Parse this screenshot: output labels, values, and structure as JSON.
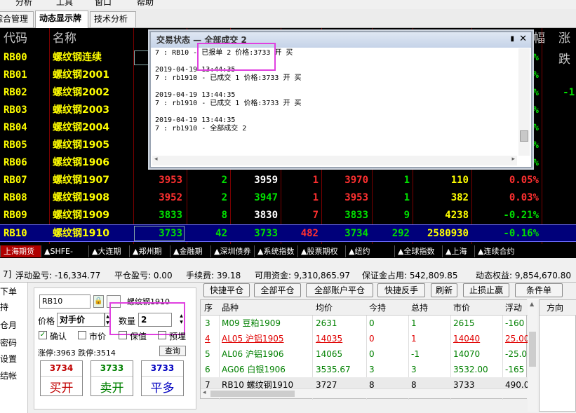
{
  "menu": {
    "items": [
      "分析",
      "工具",
      "窗口",
      "帮助"
    ]
  },
  "tabs": [
    "综合管理",
    "动态显示牌",
    "技术分析"
  ],
  "quote": {
    "headers": {
      "code": "代码",
      "name": "名称",
      "fu": "幅",
      "zhangdie": "涨跌"
    },
    "rows": [
      {
        "code": "RB00",
        "name": "螺纹钢连续",
        "right": "%"
      },
      {
        "code": "RB01",
        "name": "螺纹钢2001",
        "right": "%"
      },
      {
        "code": "RB02",
        "name": "螺纹钢2002",
        "right": "%",
        "far": "-1"
      },
      {
        "code": "RB03",
        "name": "螺纹钢2003",
        "right": "%"
      },
      {
        "code": "RB04",
        "name": "螺纹钢2004",
        "right": "%"
      },
      {
        "code": "RB05",
        "name": "螺纹钢1905",
        "right": "%"
      },
      {
        "code": "RB06",
        "name": "螺纹钢1906",
        "right": "%"
      },
      {
        "code": "RB07",
        "name": "螺纹钢1907",
        "bid": "3953",
        "bidv": "2",
        "ask": "3959",
        "askv": "1",
        "last": "3970",
        "vol": "1",
        "oi": "110",
        "pct": "0.05%"
      },
      {
        "code": "RB08",
        "name": "螺纹钢1908",
        "bid": "3952",
        "bidv": "2",
        "ask": "3947",
        "askv": "1",
        "last": "3953",
        "vol": "1",
        "oi": "382",
        "pct": "0.03%"
      },
      {
        "code": "RB09",
        "name": "螺纹钢1909",
        "bid": "3833",
        "bidv": "8",
        "ask": "3830",
        "askv": "7",
        "last": "3833",
        "vol": "9",
        "oi": "4238",
        "pct": "-0.21%"
      },
      {
        "code": "RB10",
        "name": "螺纹钢1910",
        "bid": "3733",
        "bidv": "42",
        "ask": "3733",
        "askv": "482",
        "last": "3734",
        "vol": "292",
        "oi": "2580930",
        "pct": "-0.16%"
      }
    ]
  },
  "popup": {
    "title": "交易状态 — 全部成交 2",
    "pin": "▮",
    "close": "✕",
    "lines": [
      "7 : RB10 - 已报单 2 价格:3733 开 买",
      "",
      "2019-04-19 13:44:35",
      "7 : rb1910 - 已成交 1 价格:3733 开 买",
      "",
      "2019-04-19 13:44:35",
      "7 : rb1910 - 已成交 1 价格:3733 开 买",
      "",
      "2019-04-19 13:44:35",
      "7 : rb1910 - 全部成交 2"
    ]
  },
  "exchange_tabs": [
    "上海期货",
    "▲SHFE-INE",
    "▲大连期货",
    "▲郑州期货",
    "▲金融期货",
    "▲深圳债券",
    "▲系统指数",
    "▲股票期权",
    "▲纽约NYMEX",
    "▲全球指数",
    "▲上海T",
    "▲连续合约"
  ],
  "status": {
    "float_pl": "浮动盈亏: -16,334.77",
    "close_pl": "平仓盈亏: 0.00",
    "fee": "手续费: 39.18",
    "available": "可用资金: 9,310,865.97",
    "margin": "保证金占用: 542,809.85",
    "equity": "动态权益: 9,854,670.80"
  },
  "leftmenu": [
    "下单",
    "持",
    "仓月",
    "密码",
    "设置",
    "结帐"
  ],
  "order": {
    "contract": "RB10",
    "contract_name": "螺纹钢1910",
    "price_label": "价格",
    "price_value": "对手价",
    "qty_label": "数量",
    "qty_value": "2",
    "confirm_label": "确认",
    "market_label": "市价",
    "hedge_label": "保值",
    "preorder_label": "预埋",
    "limits": "涨停:3963 跌停:3514",
    "query_btn": "查询",
    "buy_price": "3734",
    "buy_label": "买开",
    "sell_price": "3733",
    "sell_label": "卖开",
    "close_price": "3733",
    "close_label": "平多"
  },
  "toolbar": [
    "快捷平仓",
    "全部平仓",
    "全部账户平仓",
    "快捷反手",
    "刷新",
    "止损止赢",
    "条件单"
  ],
  "positions": {
    "headers": [
      "序",
      "品种",
      "均价",
      "今持",
      "总持",
      "市价",
      "浮动"
    ],
    "rows": [
      {
        "idx": "3",
        "name": "M09 豆粕1909",
        "avg": "2631",
        "today": "0",
        "total": "1",
        "mkt": "2615",
        "float": "-160",
        "color": "#008000"
      },
      {
        "idx": "4",
        "name": "AL05 沪铝1905",
        "avg": "14035",
        "today": "0",
        "total": "1",
        "mkt": "14040",
        "float": "25.00",
        "color": "#e00000"
      },
      {
        "idx": "5",
        "name": "AL06 沪铝1906",
        "avg": "14065",
        "today": "0",
        "total": "-1",
        "mkt": "14070",
        "float": "-25.0",
        "color": "#008000"
      },
      {
        "idx": "6",
        "name": "AG06 白银1906",
        "avg": "3535.67",
        "today": "3",
        "total": "3",
        "mkt": "3532.00",
        "float": "-165",
        "color": "#008000"
      },
      {
        "idx": "7",
        "name": "RB10 螺纹钢1910",
        "avg": "3727",
        "today": "8",
        "total": "8",
        "mkt": "3733",
        "float": "490.0",
        "color": "#000000"
      }
    ]
  },
  "right_header": "方向"
}
